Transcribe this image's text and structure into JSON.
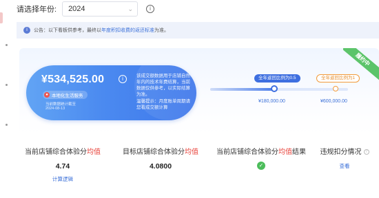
{
  "year_filter": {
    "label": "请选择年份:",
    "value": "2024",
    "chevron_icon": "chevron-down-icon",
    "info_icon": "info-icon"
  },
  "notice": {
    "icon": "info-icon",
    "prefix": "公告：以下看板供参考，最终以",
    "link": "年度积扣收费的返还标准",
    "suffix": "为准。"
  },
  "ribbon": {
    "label": "履约中",
    "color": "#5cc46a"
  },
  "hero": {
    "amount": "¥534,525.00",
    "info_icon": "info-icon",
    "tag": "本地化生活服务",
    "date_caption": "当前数据统计截至",
    "date": "2024-08-13",
    "desc": "该成交额数据用于店铺自然年内的技术年费结算，当前数据仅供参考，以实际结算为准。",
    "warm_tip": "温馨提示：月度账单周期请您看成交额计算",
    "colors": {
      "start": "#62a4f4",
      "end": "#3e77eb"
    }
  },
  "threshold": {
    "a_label": "全年返回比例为0.5",
    "a_value": "¥180,000.00",
    "b_label": "全年返回比例为1",
    "b_value": "¥600,000.00",
    "progress": 0.46,
    "colors": {
      "a": "#3e6fe0",
      "b": "#f29a3a"
    }
  },
  "metrics": [
    {
      "title_pre": "当前店铺综合体验分",
      "title_hl": "均值",
      "title_post": "",
      "value": "4.74",
      "link": "计算逻辑"
    },
    {
      "title_pre": "目标店铺综合体验分",
      "title_hl": "均值",
      "title_post": "",
      "value": "4.0800",
      "link": ""
    },
    {
      "title_pre": "当前店铺综合体验分",
      "title_hl": "均值",
      "title_post": "结果",
      "value": "",
      "link": "",
      "icon": "check-circle-icon"
    },
    {
      "title_pre": "违规扣分情况",
      "title_hl": "",
      "title_post": "",
      "value": "",
      "link": "查看",
      "icon": "question-icon"
    }
  ],
  "highlight_color": "#e8423a"
}
